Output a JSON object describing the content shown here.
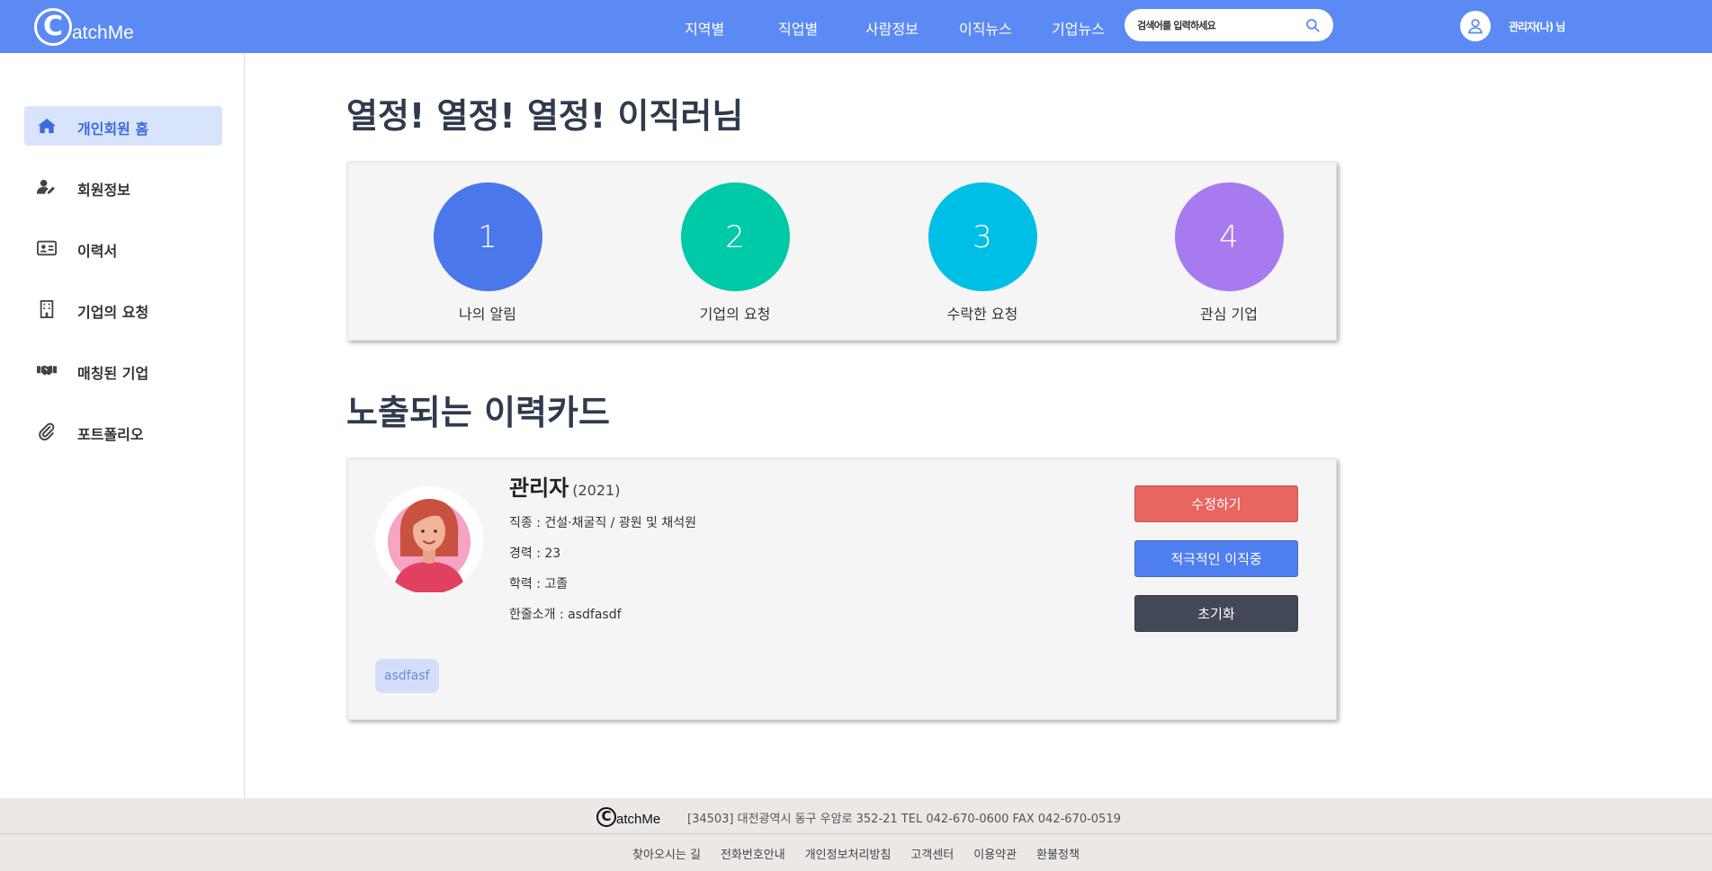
{
  "header": {
    "logo_letter": "C",
    "logo_text": "atchMe",
    "nav": [
      "지역별",
      "직업별",
      "사람정보",
      "이직뉴스",
      "기업뉴스"
    ],
    "search_placeholder": "검색어를 입력하세요",
    "user_name": "관리자(나) 님",
    "brand_color": "#5b8af5"
  },
  "sidebar": {
    "items": [
      {
        "label": "개인회원 홈",
        "icon": "home-icon",
        "active": true
      },
      {
        "label": "회원정보",
        "icon": "user-edit-icon",
        "active": false
      },
      {
        "label": "이력서",
        "icon": "id-card-icon",
        "active": false
      },
      {
        "label": "기업의 요청",
        "icon": "building-icon",
        "active": false
      },
      {
        "label": "매칭된 기업",
        "icon": "handshake-icon",
        "active": false
      },
      {
        "label": "포트폴리오",
        "icon": "paperclip-icon",
        "active": false
      }
    ]
  },
  "main": {
    "title": "열정! 열정! 열정! 이직러님",
    "stats": [
      {
        "value": "1",
        "label": "나의 알림",
        "color": "#4a78ea"
      },
      {
        "value": "2",
        "label": "기업의 요청",
        "color": "#00c9a7"
      },
      {
        "value": "3",
        "label": "수락한 요청",
        "color": "#00bfe6"
      },
      {
        "value": "4",
        "label": "관심 기업",
        "color": "#a77af0"
      }
    ],
    "section_title": "노출되는 이력카드",
    "card": {
      "name": "관리자",
      "year": "(2021)",
      "job": "직종 : 건설·채굴직 / 광원 및 채석원",
      "career": "경력 : 23",
      "education": "학력 : 고졸",
      "intro": "한줄소개 : asdfasdf",
      "tag": "asdfasf",
      "buttons": {
        "edit": "수정하기",
        "active": "적극적인 이직중",
        "reset": "초기화"
      }
    }
  },
  "footer": {
    "logo_letter": "C",
    "logo_text": "atchMe",
    "address": "[34503] 대전광역시 동구 우암로 352-21 TEL 042-670-0600 FAX 042-670-0519",
    "links": [
      "찾아오시는 길",
      "전화번호안내",
      "개인정보처리방침",
      "고객센터",
      "이용약관",
      "환불정책"
    ]
  }
}
